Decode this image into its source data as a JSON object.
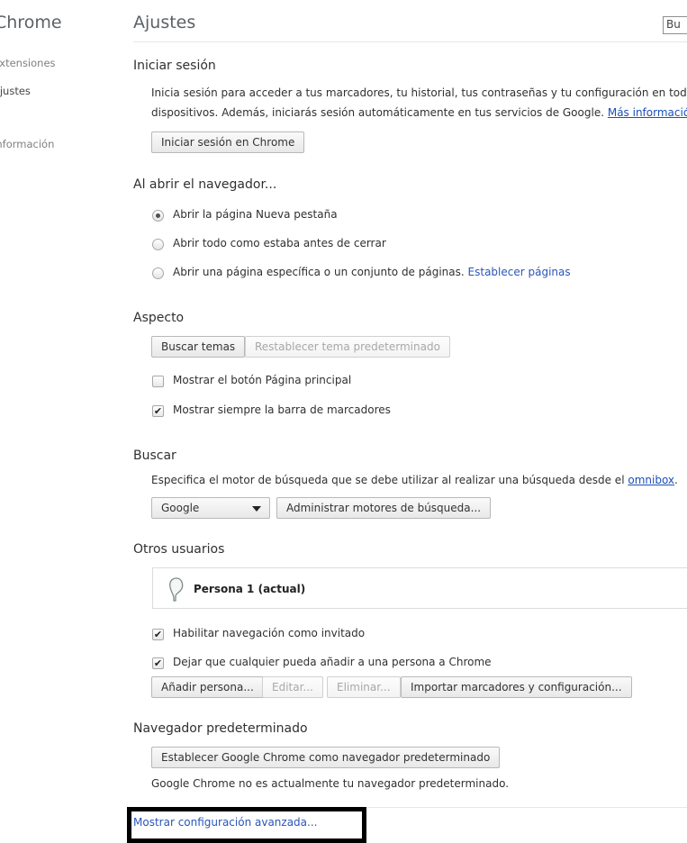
{
  "sidebar": {
    "title": "Chrome",
    "items": [
      {
        "label": "Extensiones"
      },
      {
        "label": "Ajustes"
      },
      {
        "label": "Información"
      }
    ]
  },
  "header": {
    "title": "Ajustes",
    "search_value": "Bu"
  },
  "signin": {
    "heading": "Iniciar sesión",
    "line1": "Inicia sesión para acceder a tus marcadores, tu historial, tus contraseñas y tu configuración en todos tus",
    "line2": "dispositivos. Además, iniciarás sesión automáticamente en tus servicios de Google.",
    "more_link": "Más información",
    "button": "Iniciar sesión en Chrome"
  },
  "startup": {
    "heading": "Al abrir el navegador...",
    "options": [
      {
        "label": "Abrir la página Nueva pestaña",
        "checked": true
      },
      {
        "label": "Abrir todo como estaba antes de cerrar",
        "checked": false
      },
      {
        "label": "Abrir una página específica o un conjunto de páginas.",
        "checked": false
      }
    ],
    "set_pages_link": "Establecer páginas"
  },
  "appearance": {
    "heading": "Aspecto",
    "get_themes": "Buscar temas",
    "reset_theme": "Restablecer tema predeterminado",
    "show_home": {
      "label": "Mostrar el botón Página principal",
      "checked": false
    },
    "show_bookmarks": {
      "label": "Mostrar siempre la barra de marcadores",
      "checked": true
    }
  },
  "search": {
    "heading": "Buscar",
    "description": "Especifica el motor de búsqueda que se debe utilizar al realizar una búsqueda desde el",
    "omnibox_link": "omnibox",
    "engine": "Google",
    "manage_button": "Administrar motores de búsqueda..."
  },
  "users": {
    "heading": "Otros usuarios",
    "current_user": "Persona 1 (actual)",
    "guest": {
      "label": "Habilitar navegación como invitado",
      "checked": true
    },
    "anyone_add": {
      "label": "Dejar que cualquier pueda añadir a una persona a Chrome",
      "checked": true
    },
    "add_button": "Añadir persona...",
    "edit_button": "Editar...",
    "delete_button": "Eliminar...",
    "import_button": "Importar marcadores y configuración..."
  },
  "default_browser": {
    "heading": "Navegador predeterminado",
    "button": "Establecer Google Chrome como navegador predeterminado",
    "status": "Google Chrome no es actualmente tu navegador predeterminado."
  },
  "advanced_link": "Mostrar configuración avanzada..."
}
